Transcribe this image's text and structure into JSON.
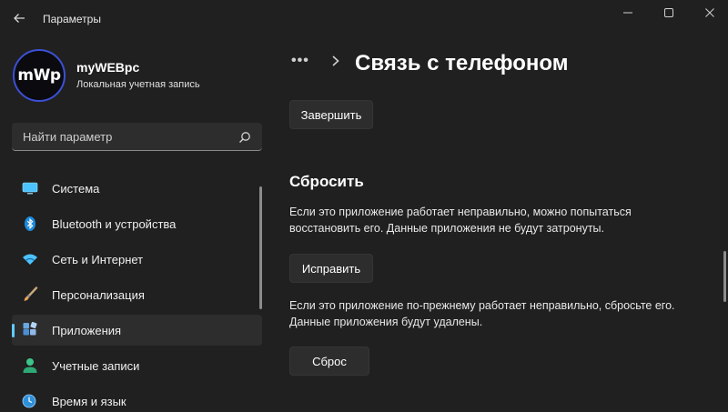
{
  "window": {
    "title": "Параметры"
  },
  "profile": {
    "avatar_text": "mWp",
    "name": "myWEBpc",
    "account_type": "Локальная учетная запись"
  },
  "search": {
    "placeholder": "Найти параметр"
  },
  "sidebar": {
    "items": [
      {
        "label": "Система",
        "icon": "monitor-icon",
        "active": false
      },
      {
        "label": "Bluetooth и устройства",
        "icon": "bluetooth-icon",
        "active": false
      },
      {
        "label": "Сеть и Интернет",
        "icon": "wifi-icon",
        "active": false
      },
      {
        "label": "Персонализация",
        "icon": "brush-icon",
        "active": false
      },
      {
        "label": "Приложения",
        "icon": "apps-icon",
        "active": true
      },
      {
        "label": "Учетные записи",
        "icon": "person-icon",
        "active": false
      },
      {
        "label": "Время и язык",
        "icon": "globe-clock-icon",
        "active": false
      }
    ]
  },
  "header": {
    "breadcrumb_more": "•••",
    "page_title": "Связь с телефоном"
  },
  "main": {
    "finish_button": "Завершить",
    "reset_section": {
      "title": "Сбросить",
      "repair_text": "Если это приложение работает неправильно, можно попытаться восстановить его. Данные приложения не будут затронуты.",
      "repair_button": "Исправить",
      "reset_text": "Если это приложение по-прежнему работает неправильно, сбросьте его. Данные приложения будут удалены.",
      "reset_button": "Сброс"
    }
  },
  "colors": {
    "background": "#202020",
    "accent": "#60cdff",
    "button": "#2d2d2d"
  }
}
